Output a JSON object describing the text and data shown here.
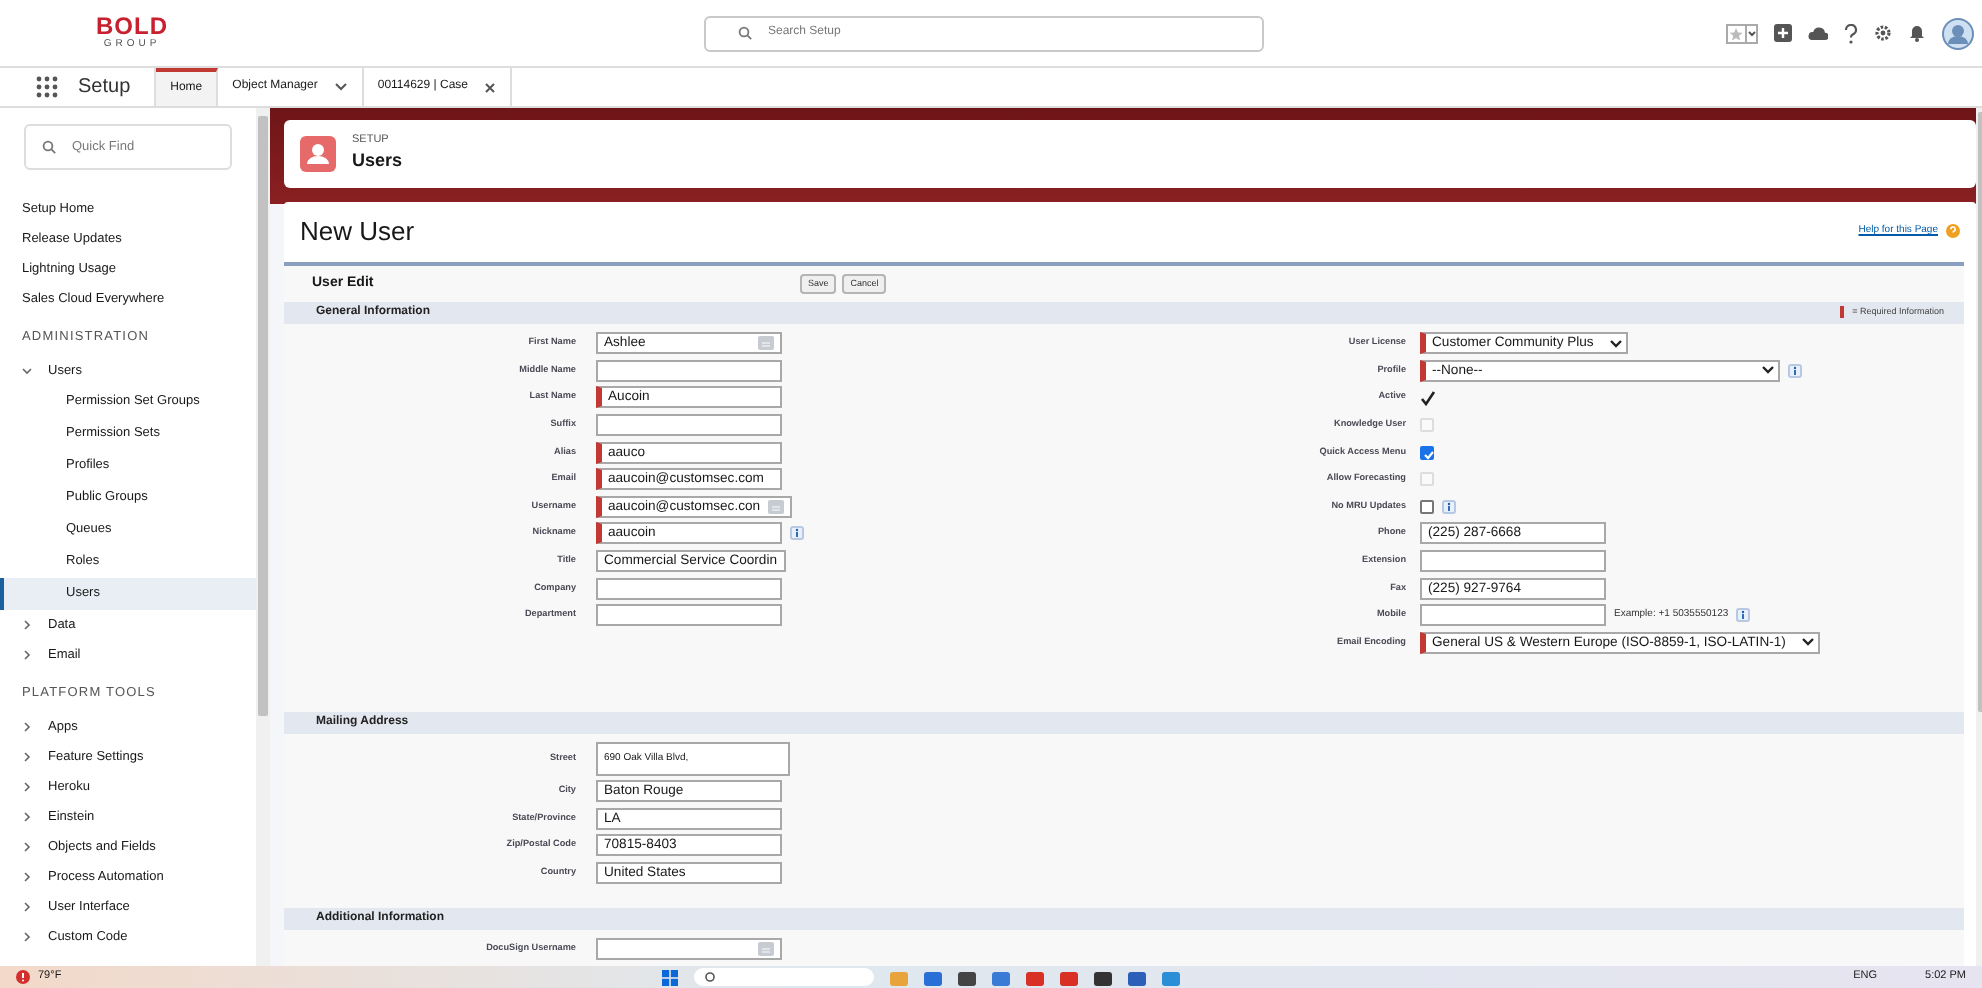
{
  "header": {
    "logo_top": "BOLD",
    "logo_bottom": "GROUP",
    "search_placeholder": "Search Setup"
  },
  "nav": {
    "app_name": "Setup",
    "tabs": [
      {
        "label": "Home",
        "selected": true,
        "kind": "plain"
      },
      {
        "label": "Object Manager",
        "selected": false,
        "kind": "menu"
      },
      {
        "label": "00114629 | Case",
        "selected": false,
        "kind": "closable"
      }
    ]
  },
  "sidebar": {
    "search_placeholder": "Quick Find",
    "items": [
      {
        "kind": "link",
        "label": "Setup Home"
      },
      {
        "kind": "link",
        "label": "Release Updates"
      },
      {
        "kind": "link",
        "label": "Lightning Usage"
      },
      {
        "kind": "link",
        "label": "Sales Cloud Everywhere"
      },
      {
        "kind": "heading",
        "label": "ADMINISTRATION"
      },
      {
        "kind": "group",
        "label": "Users",
        "expanded": true,
        "children": [
          {
            "label": "Permission Set Groups",
            "selected": false
          },
          {
            "label": "Permission Sets",
            "selected": false
          },
          {
            "label": "Profiles",
            "selected": false
          },
          {
            "label": "Public Groups",
            "selected": false
          },
          {
            "label": "Queues",
            "selected": false
          },
          {
            "label": "Roles",
            "selected": false
          },
          {
            "label": "Users",
            "selected": true
          }
        ]
      },
      {
        "kind": "group",
        "label": "Data",
        "expanded": false
      },
      {
        "kind": "group",
        "label": "Email",
        "expanded": false
      },
      {
        "kind": "heading",
        "label": "PLATFORM TOOLS"
      },
      {
        "kind": "group",
        "label": "Apps",
        "expanded": false
      },
      {
        "kind": "group",
        "label": "Feature Settings",
        "expanded": false
      },
      {
        "kind": "group",
        "label": "Heroku",
        "expanded": false
      },
      {
        "kind": "group",
        "label": "Einstein",
        "expanded": false
      },
      {
        "kind": "group",
        "label": "Objects and Fields",
        "expanded": false
      },
      {
        "kind": "group",
        "label": "Process Automation",
        "expanded": false
      },
      {
        "kind": "group",
        "label": "User Interface",
        "expanded": false
      },
      {
        "kind": "group",
        "label": "Custom Code",
        "expanded": false
      }
    ]
  },
  "page_header": {
    "eyebrow": "SETUP",
    "title": "Users"
  },
  "form": {
    "title": "New User",
    "help_link": "Help for this Page",
    "block_title": "User Edit",
    "buttons": [
      "Save",
      "Cancel"
    ],
    "sections": [
      {
        "title": "General Information",
        "legend": "= Required Information",
        "columns": [
          [
            {
              "label": "First Name",
              "kind": "text",
              "value": "Ashlee",
              "required": false,
              "lookup": true
            },
            {
              "label": "Middle Name",
              "kind": "text",
              "required": false
            },
            {
              "label": "Last Name",
              "kind": "text",
              "value": "Aucoin",
              "required": true
            },
            {
              "label": "Suffix",
              "kind": "text",
              "required": false
            },
            {
              "label": "Alias",
              "kind": "text",
              "value": "aauco",
              "required": true
            },
            {
              "label": "Email",
              "kind": "text",
              "value": "aaucoin@customsec.com",
              "required": true
            },
            {
              "label": "Username",
              "kind": "text",
              "value": "aaucoin@customsec.con",
              "required": true,
              "lookup": true
            },
            {
              "label": "Nickname",
              "kind": "text",
              "value": "aaucoin",
              "required": true,
              "info": true
            },
            {
              "label": "Title",
              "kind": "text",
              "value": "Commercial Service Coordin",
              "required": false
            },
            {
              "label": "Company",
              "kind": "text",
              "required": false
            },
            {
              "label": "Department",
              "kind": "text",
              "required": false
            }
          ],
          [
            {
              "label": "User License",
              "kind": "select",
              "value": "Customer Community Plus",
              "required": true
            },
            {
              "label": "Profile",
              "kind": "select",
              "value": "--None--",
              "required": true,
              "info": true
            },
            {
              "label": "Active",
              "kind": "check",
              "checked": true
            },
            {
              "label": "Knowledge User",
              "kind": "checkbox",
              "checked": false,
              "disabled": true
            },
            {
              "label": "Quick Access Menu",
              "kind": "checkbox",
              "checked": true,
              "disabled": false
            },
            {
              "label": "Allow Forecasting",
              "kind": "checkbox",
              "checked": false,
              "disabled": true
            },
            {
              "label": "No MRU Updates",
              "kind": "checkbox",
              "checked": false,
              "disabled": false,
              "info": true
            },
            {
              "label": "Phone",
              "kind": "text",
              "value": "(225) 287-6668",
              "required": false
            },
            {
              "label": "Extension",
              "kind": "text",
              "required": false
            },
            {
              "label": "Fax",
              "kind": "text",
              "value": "(225) 927-9764",
              "required": false
            },
            {
              "label": "Mobile",
              "kind": "text",
              "required": false,
              "hint": "Example: +1 5035550123",
              "info": true
            },
            {
              "label": "Email Encoding",
              "kind": "select",
              "value": "General US & Western Europe (ISO-8859-1, ISO-LATIN-1)",
              "required": true
            }
          ]
        ]
      },
      {
        "title": "Mailing Address",
        "columns": [
          [
            {
              "label": "Street",
              "kind": "textarea",
              "value": "690 Oak Villa Blvd,",
              "required": false
            },
            {
              "label": "City",
              "kind": "text",
              "value": "Baton Rouge",
              "required": false
            },
            {
              "label": "State/Province",
              "kind": "text",
              "value": "LA",
              "required": false
            },
            {
              "label": "Zip/Postal Code",
              "kind": "text",
              "value": "70815-8403",
              "required": false
            },
            {
              "label": "Country",
              "kind": "text",
              "value": "United States",
              "required": false
            }
          ]
        ]
      },
      {
        "title": "Additional Information",
        "columns": [
          [
            {
              "label": "DocuSign Username",
              "kind": "text",
              "required": false,
              "lookup": true
            }
          ]
        ]
      }
    ]
  },
  "taskbar": {
    "weather": "79°F",
    "language": "ENG",
    "time": "5:02 PM"
  }
}
